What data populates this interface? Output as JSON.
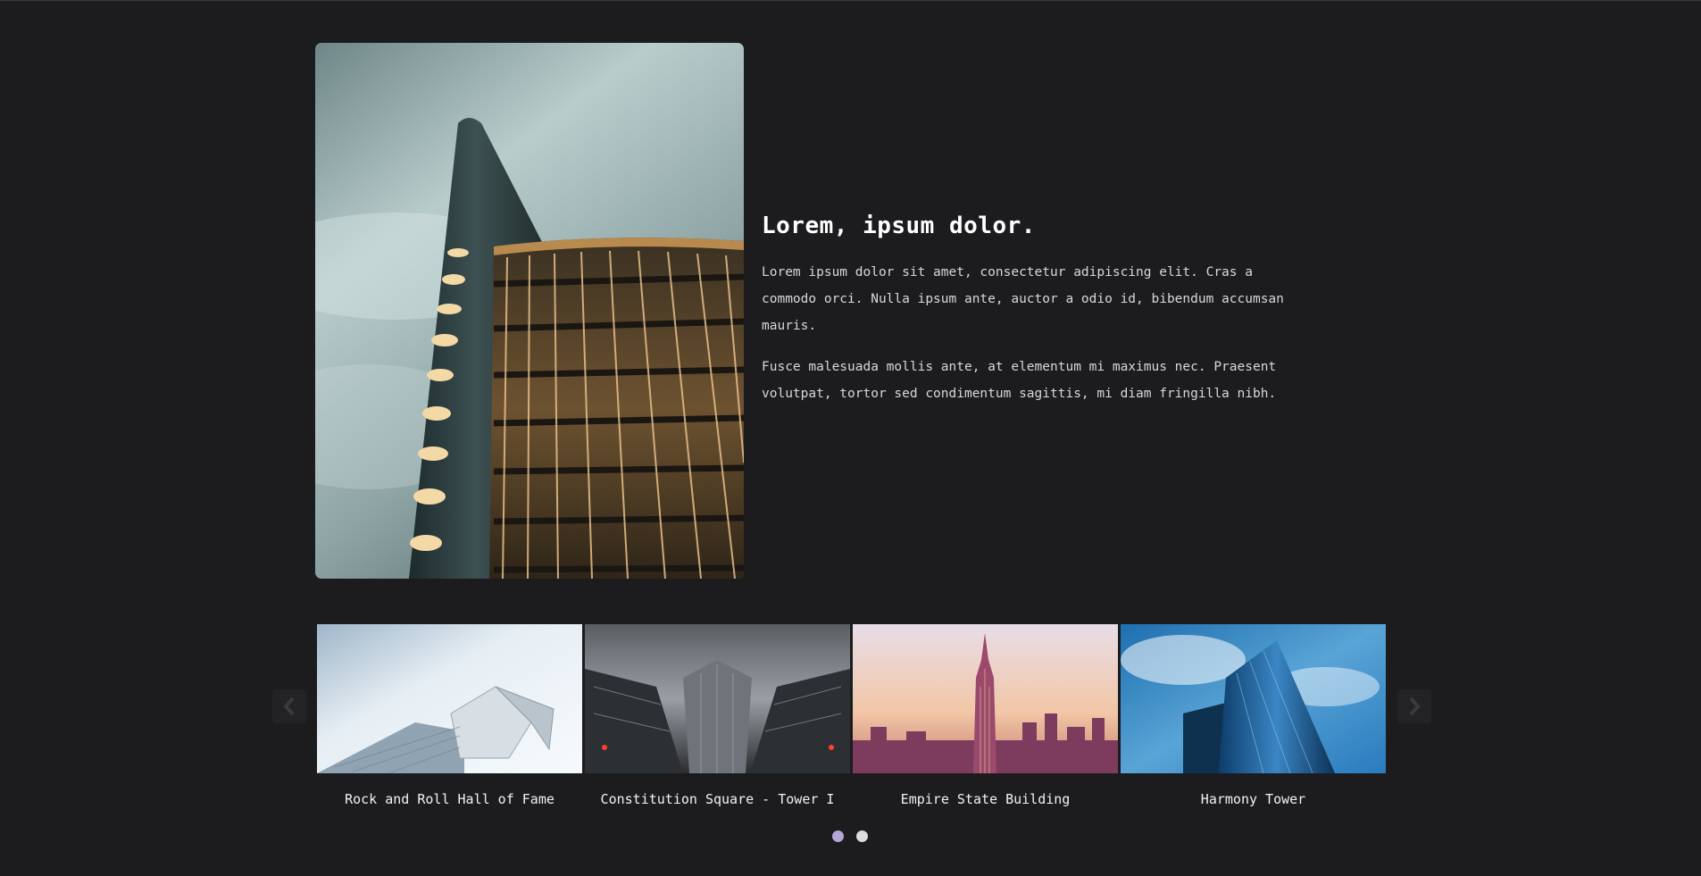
{
  "hero": {
    "title": "Lorem, ipsum dolor.",
    "paragraphs": [
      "Lorem ipsum dolor sit amet, consectetur adipiscing elit. Cras a commodo orci. Nulla ipsum ante, auctor a odio id, bibendum accumsan mauris.",
      "Fusce malesuada mollis ante, at elementum mi maximus nec. Praesent volutpat, tortor sed condimentum sagittis, mi diam fringilla nibh."
    ],
    "image_icon": "office-building-photo"
  },
  "carousel": {
    "cards": [
      {
        "caption": "Rock and Roll Hall of Fame"
      },
      {
        "caption": "Constitution Square - Tower I"
      },
      {
        "caption": "Empire State Building"
      },
      {
        "caption": "Harmony Tower"
      }
    ],
    "prev_icon": "chevron-left-icon",
    "next_icon": "chevron-right-icon",
    "pagination": {
      "total": 2,
      "active": 1
    },
    "colors": {
      "dot_active": "#b3a6d6",
      "dot_inactive": "#dcdcdc"
    }
  }
}
